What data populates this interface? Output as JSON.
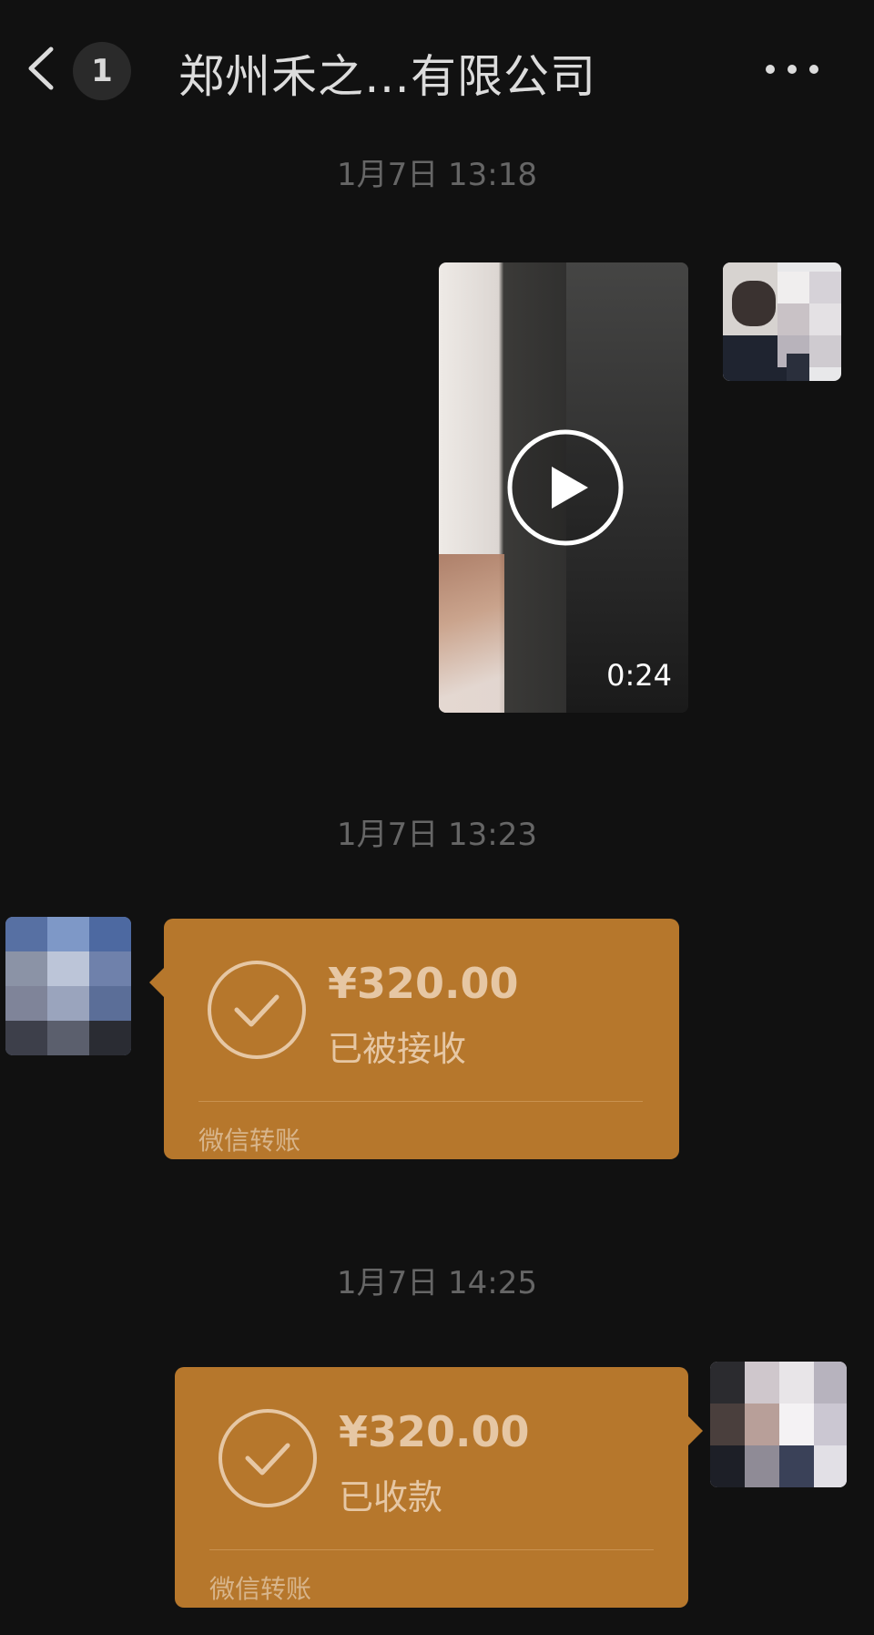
{
  "header": {
    "back_icon": "chevron-left-icon",
    "unread_count": "1",
    "title": "郑州禾之…有限公司",
    "more_icon": "more-horizontal-icon"
  },
  "messages": [
    {
      "kind": "timestamp",
      "text": "1月7日 13:18"
    },
    {
      "kind": "video",
      "side": "right",
      "duration": "0:24",
      "play_icon": "play-circle-icon"
    },
    {
      "kind": "timestamp",
      "text": "1月7日 13:23"
    },
    {
      "kind": "transfer",
      "side": "left",
      "amount": "¥320.00",
      "status": "已被接收",
      "footer": "微信转账",
      "icon": "check-circle-icon"
    },
    {
      "kind": "timestamp",
      "text": "1月7日 14:25"
    },
    {
      "kind": "transfer",
      "side": "right",
      "amount": "¥320.00",
      "status": "已收款",
      "footer": "微信转账",
      "icon": "check-circle-icon"
    }
  ],
  "colors": {
    "background": "#111111",
    "card": "#b6772c",
    "card_text": "#e6c7a4",
    "timestamp": "#666666"
  }
}
